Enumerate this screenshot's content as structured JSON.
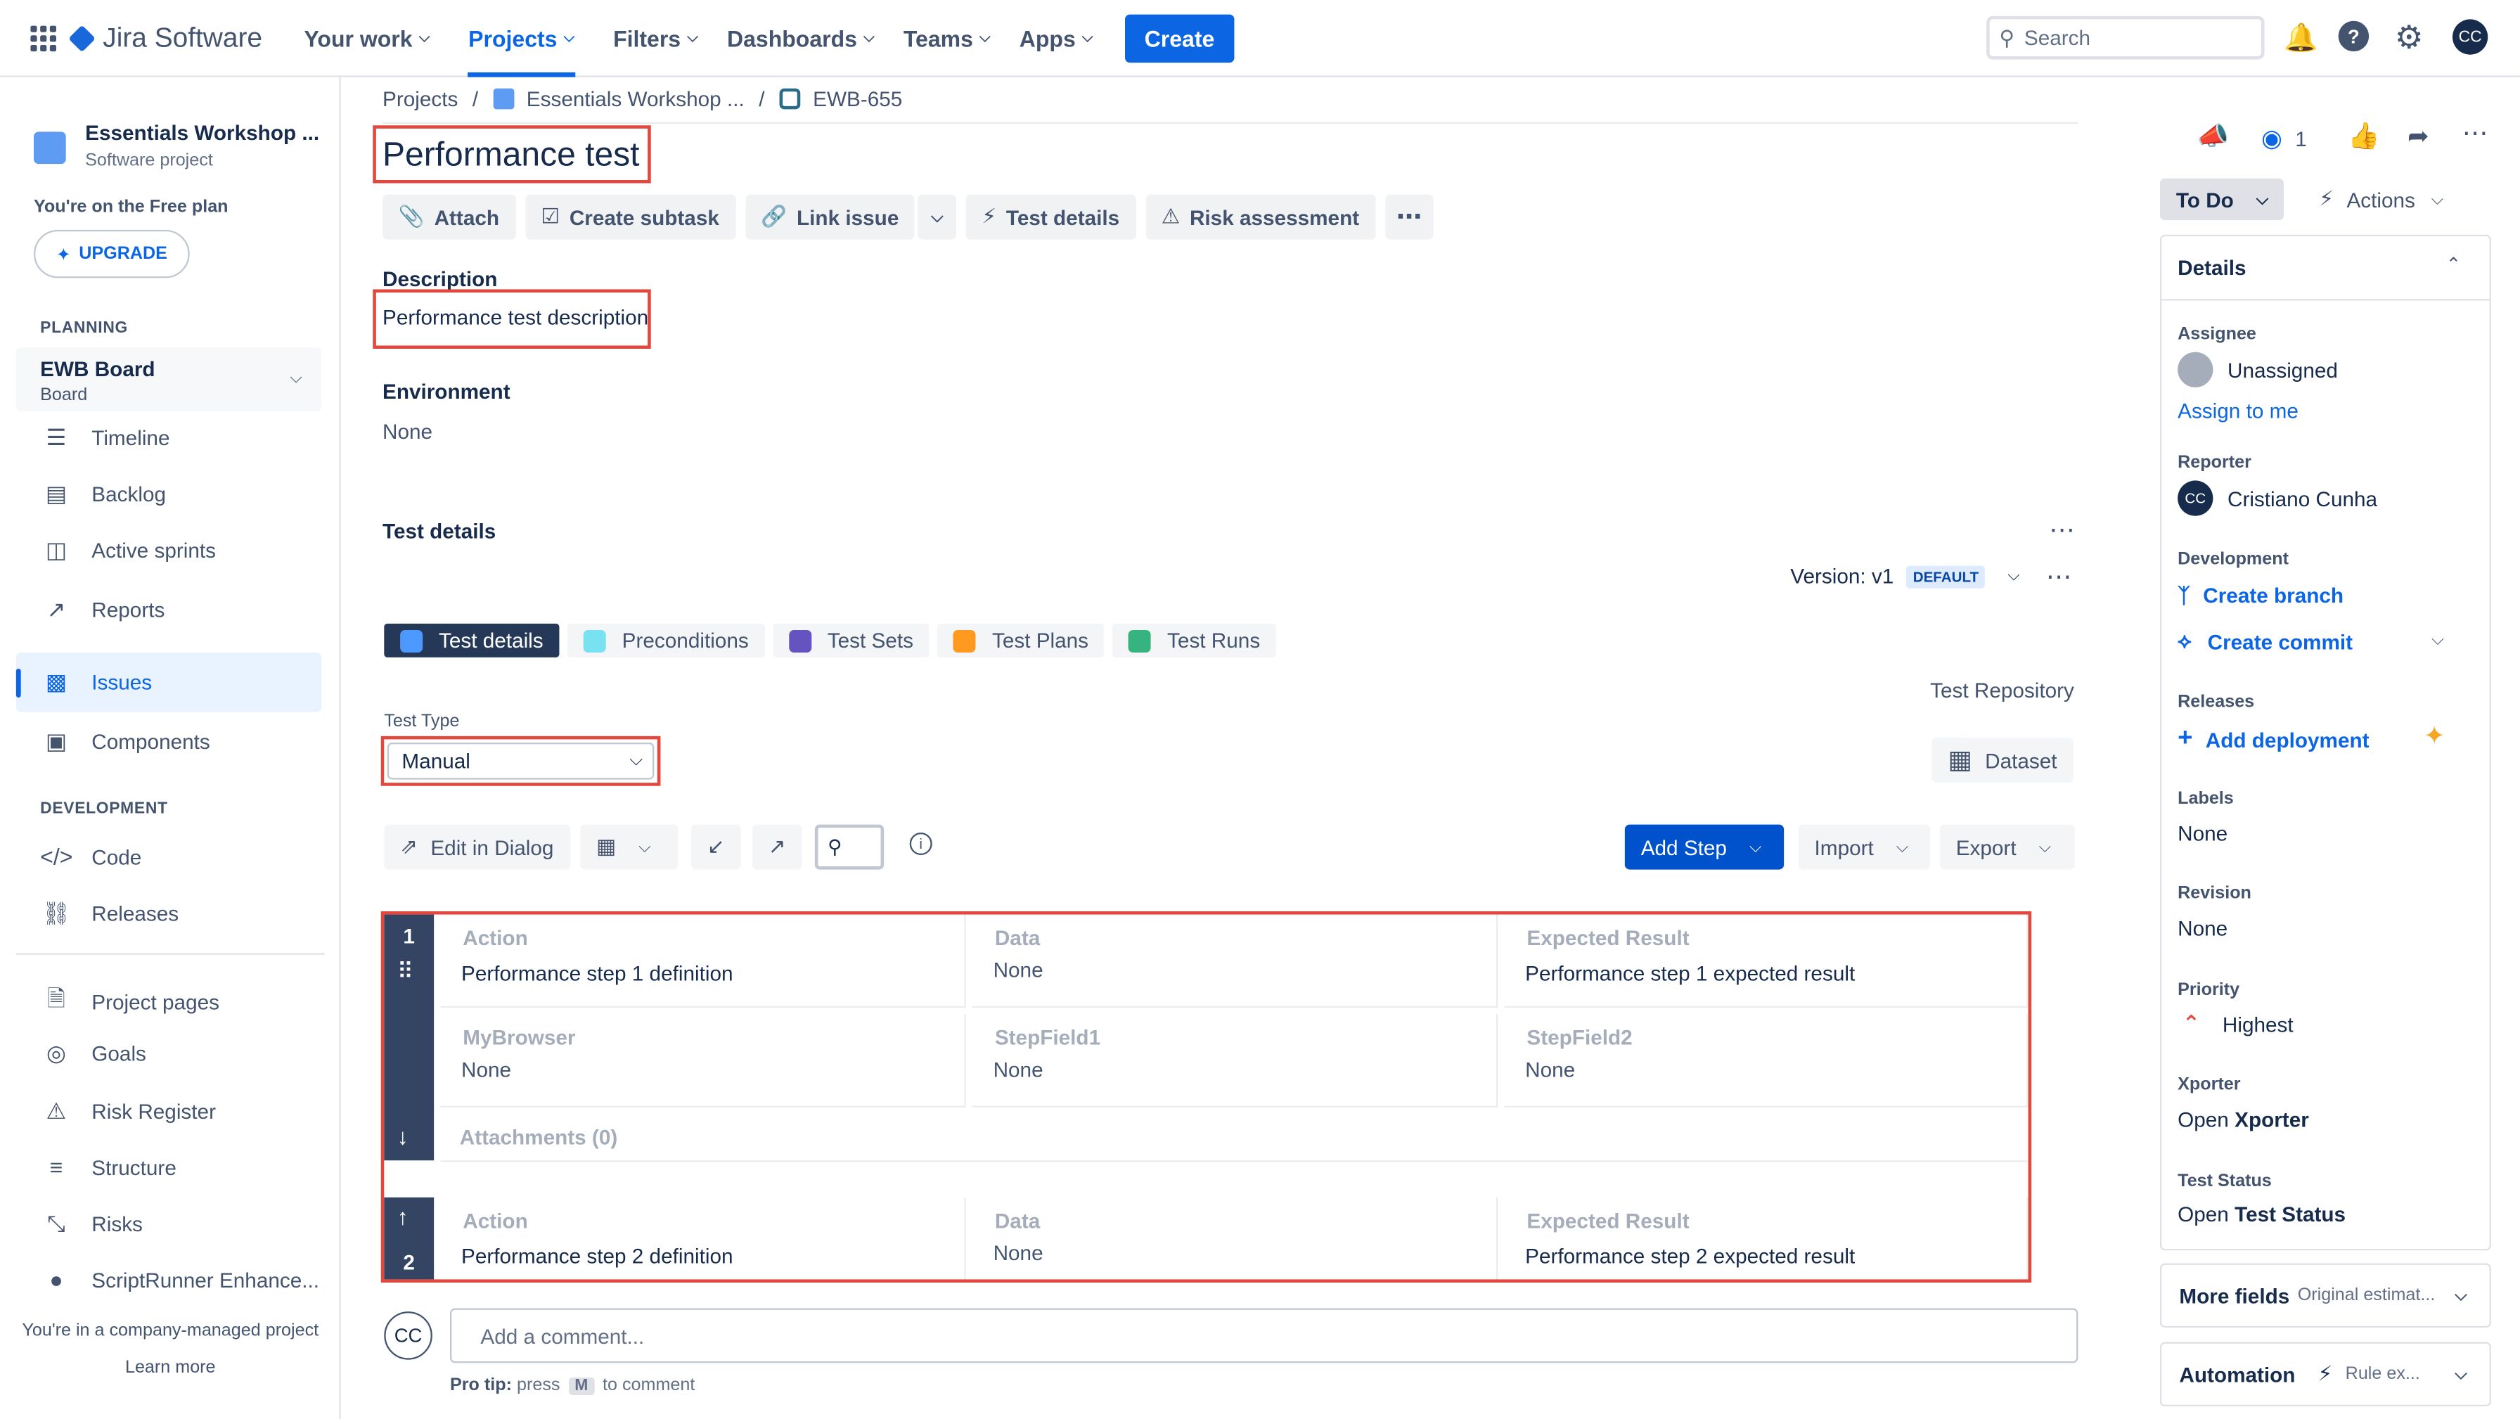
{
  "topnav": {
    "product": "Jira Software",
    "items": [
      {
        "label": "Your work"
      },
      {
        "label": "Projects"
      },
      {
        "label": "Filters"
      },
      {
        "label": "Dashboards"
      },
      {
        "label": "Teams"
      },
      {
        "label": "Apps"
      }
    ],
    "create": "Create",
    "search_placeholder": "Search",
    "avatar": "CC"
  },
  "sidebar": {
    "project_name": "Essentials Workshop ...",
    "project_type": "Software project",
    "free_plan": "You're on the Free plan",
    "upgrade": "UPGRADE",
    "planning": "PLANNING",
    "board_name": "EWB Board",
    "board_type": "Board",
    "planning_items": [
      "Timeline",
      "Backlog",
      "Active sprints",
      "Reports",
      "Issues",
      "Components"
    ],
    "development": "DEVELOPMENT",
    "dev_items": [
      "Code",
      "Releases"
    ],
    "other_items": [
      "Project pages",
      "Goals",
      "Risk Register",
      "Structure",
      "Risks",
      "ScriptRunner Enhance..."
    ],
    "company_managed": "You're in a company-managed project",
    "learn_more": "Learn more"
  },
  "breadcrumbs": {
    "projects": "Projects",
    "project": "Essentials Workshop ...",
    "issue": "EWB-655"
  },
  "issue": {
    "title": "Performance test",
    "toolbar": {
      "attach": "Attach",
      "create_subtask": "Create subtask",
      "link_issue": "Link issue",
      "test_details": "Test details",
      "risk_assessment": "Risk assessment"
    },
    "description_label": "Description",
    "description": "Performance test description",
    "environment_label": "Environment",
    "environment": "None"
  },
  "test_details": {
    "heading": "Test details",
    "version": "Version: v1",
    "version_badge": "DEFAULT",
    "tabs": [
      "Test details",
      "Preconditions",
      "Test Sets",
      "Test Plans",
      "Test Runs"
    ],
    "test_repository": "Test Repository",
    "test_type_label": "Test Type",
    "test_type_value": "Manual",
    "dataset": "Dataset",
    "edit_in_dialog": "Edit in Dialog",
    "add_step": "Add Step",
    "import": "Import",
    "export": "Export",
    "steps": [
      {
        "number": "1",
        "action_label": "Action",
        "action": "Performance step 1 definition",
        "data_label": "Data",
        "data": "None",
        "expected_label": "Expected Result",
        "expected": "Performance step 1 expected result",
        "f1_label": "MyBrowser",
        "f1": "None",
        "f2_label": "StepField1",
        "f2": "None",
        "f3_label": "StepField2",
        "f3": "None",
        "attachments": "Attachments (0)"
      },
      {
        "number": "2",
        "action_label": "Action",
        "action": "Performance step 2 definition",
        "data_label": "Data",
        "data": "None",
        "expected_label": "Expected Result",
        "expected": "Performance step 2 expected result"
      }
    ]
  },
  "comment": {
    "avatar": "CC",
    "placeholder": "Add a comment...",
    "protip_lead": "Pro tip:",
    "protip_press": "press",
    "protip_key": "M",
    "protip_tail": "to comment"
  },
  "right_panel": {
    "watchers": "1",
    "status": "To Do",
    "actions": "Actions",
    "details": "Details",
    "assignee_label": "Assignee",
    "assignee": "Unassigned",
    "assign_to_me": "Assign to me",
    "reporter_label": "Reporter",
    "reporter_avatar": "CC",
    "reporter": "Cristiano Cunha",
    "development_label": "Development",
    "create_branch": "Create branch",
    "create_commit": "Create commit",
    "releases_label": "Releases",
    "add_deployment": "Add deployment",
    "labels_label": "Labels",
    "labels": "None",
    "revision_label": "Revision",
    "revision": "None",
    "priority_label": "Priority",
    "priority": "Highest",
    "xporter_label": "Xporter",
    "xporter_open": "Open",
    "xporter_name": "Xporter",
    "test_status_label": "Test Status",
    "test_status_open": "Open",
    "test_status_name": "Test Status",
    "more_fields": "More fields",
    "more_fields_hint": "Original estimat...",
    "automation": "Automation",
    "automation_hint": "Rule ex..."
  },
  "colors": {
    "accent": "#0c66e4",
    "highlight_border": "#e2483d",
    "step_bar": "#344563"
  }
}
